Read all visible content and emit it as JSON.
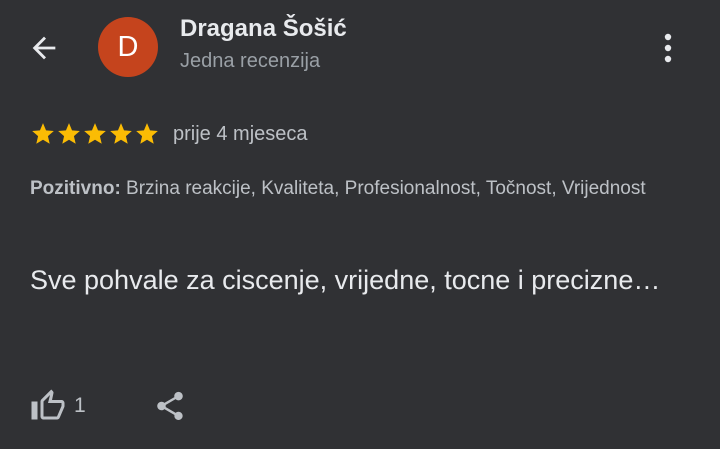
{
  "header": {
    "back_icon": "arrow-back-icon",
    "avatar_letter": "D",
    "avatar_color": "#c5441d",
    "reviewer_name": "Dragana Šošić",
    "review_count_text": "Jedna recenzija",
    "more_icon": "more-vertical-icon"
  },
  "review": {
    "rating": 5,
    "rating_max": 5,
    "star_color": "#fbbc04",
    "time": "prije 4 mjeseca",
    "attributes_label": "Pozitivno:",
    "attributes_text": " Brzina reakcije, Kvaliteta, Profesionalnost, Točnost, Vrijednost",
    "text": "Sve pohvale za ciscenje, vrijedne, tocne i precizne…"
  },
  "actions": {
    "like_icon": "thumbs-up-icon",
    "like_count": "1",
    "share_icon": "share-icon"
  },
  "colors": {
    "background": "#303134",
    "primary_text": "#e8eaed",
    "secondary_text": "#9aa0a6"
  }
}
